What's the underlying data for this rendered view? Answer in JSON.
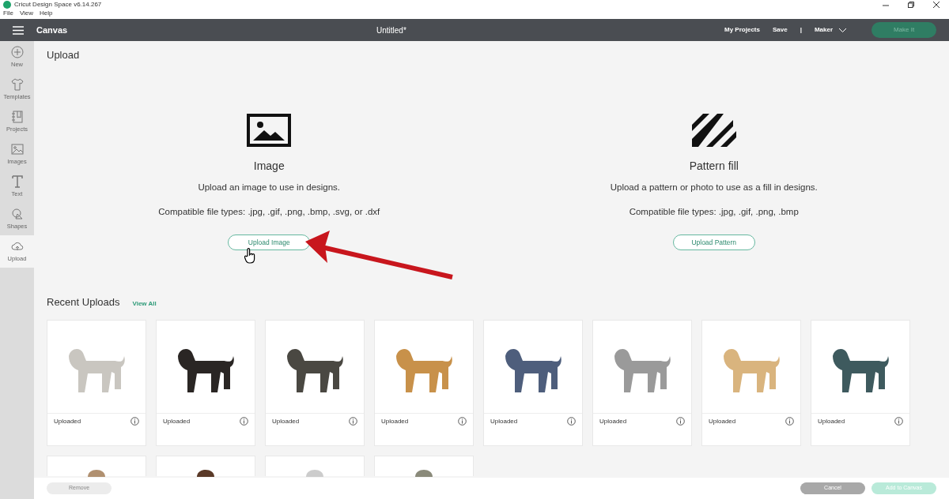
{
  "window": {
    "title": "Cricut Design Space  v6.14.267",
    "menu": [
      "File",
      "View",
      "Help"
    ]
  },
  "header": {
    "title": "Canvas",
    "document": "Untitled*",
    "links": [
      "My Projects",
      "Save",
      "|"
    ],
    "machine": "Maker",
    "make_button": {
      "label": "Make It",
      "disabled": true
    }
  },
  "sidebar": {
    "items": [
      {
        "label": "New",
        "selected": false
      },
      {
        "label": "Templates",
        "selected": false
      },
      {
        "label": "Projects",
        "selected": false
      },
      {
        "label": "Images",
        "selected": false
      },
      {
        "label": "Text",
        "selected": false
      },
      {
        "label": "Shapes",
        "selected": false
      },
      {
        "label": "Upload",
        "selected": true
      }
    ]
  },
  "page_title": "Upload",
  "options": [
    {
      "kind": "image",
      "title": "Image",
      "description": "Upload an image to use in designs.",
      "file_types": "Compatible file types: .jpg, .gif, .png, .bmp, .svg, or .dxf",
      "button": "Upload Image"
    },
    {
      "kind": "pattern",
      "title": "Pattern fill",
      "description": "Upload a pattern or photo to use as a fill in designs.",
      "file_types": "Compatible file types: .jpg, .gif, .png, .bmp",
      "button": "Upload Pattern"
    }
  ],
  "recent_uploads": {
    "title": "Recent Uploads",
    "view_all": "View All",
    "items": [
      {
        "kind": "full",
        "label": "Uploaded",
        "color": "#c9c6c0"
      },
      {
        "kind": "full",
        "label": "Uploaded",
        "color": "#2a2624"
      },
      {
        "kind": "full",
        "label": "Uploaded",
        "color": "#4a4842"
      },
      {
        "kind": "full",
        "label": "Uploaded",
        "color": "#c8914a"
      },
      {
        "kind": "full",
        "label": "Uploaded",
        "color": "#4e5e7c"
      },
      {
        "kind": "full",
        "label": "Uploaded",
        "color": "#9a9a9a"
      },
      {
        "kind": "full",
        "label": "Uploaded",
        "color": "#d9b47e"
      },
      {
        "kind": "full",
        "label": "Uploaded",
        "color": "#3e5a5e"
      },
      {
        "kind": "cut",
        "color": "#b09070"
      },
      {
        "kind": "cut",
        "color": "#5a3a28"
      },
      {
        "kind": "cut",
        "color": "#cccccc"
      },
      {
        "kind": "cut",
        "color": "#8a8a7a"
      }
    ]
  },
  "footer": {
    "buttons": [
      {
        "label": "Remove",
        "disabled": true
      },
      {
        "label": "Cancel",
        "disabled": false
      },
      {
        "label": "Add to Canvas",
        "disabled": true
      }
    ]
  }
}
